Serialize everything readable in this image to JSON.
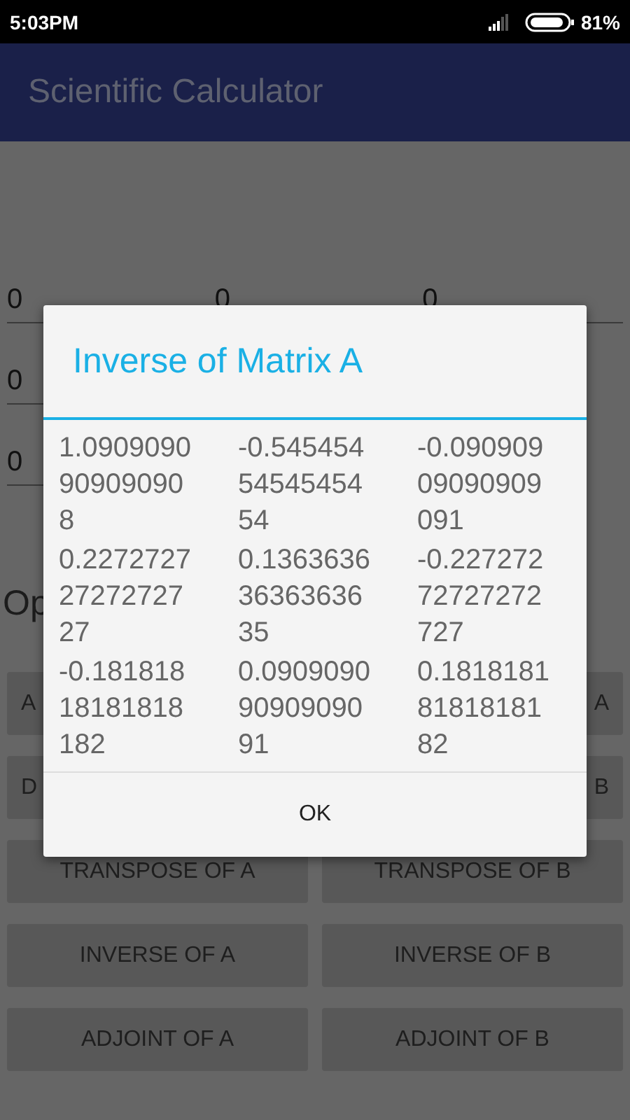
{
  "status_bar": {
    "time": "5:03PM",
    "battery": "81%"
  },
  "app_bar": {
    "title": "Scientific Calculator"
  },
  "matrix_fields": [
    [
      "0",
      "0",
      "0"
    ],
    [
      "0"
    ],
    [
      "0"
    ]
  ],
  "section_label": "Op",
  "buttons": [
    {
      "left": "A",
      "right": "A"
    },
    {
      "left": "D",
      "right": "B"
    },
    {
      "left": "TRANSPOSE OF A",
      "right": "TRANSPOSE OF B"
    },
    {
      "left": "INVERSE OF A",
      "right": "INVERSE OF B"
    },
    {
      "left": "ADJOINT OF A",
      "right": "ADJOINT OF B"
    }
  ],
  "dialog": {
    "title": "Inverse of Matrix A",
    "rows": [
      [
        "1.0909090909090908",
        "-0.5454545454545454",
        "-0.09090909090909091"
      ],
      [
        "0.22727272727272727",
        "0.13636363636363635",
        "-0.22727272727272727"
      ],
      [
        "-0.18181818181818182",
        "0.09090909090909091",
        "0.18181818181818182"
      ]
    ],
    "button": "OK"
  }
}
